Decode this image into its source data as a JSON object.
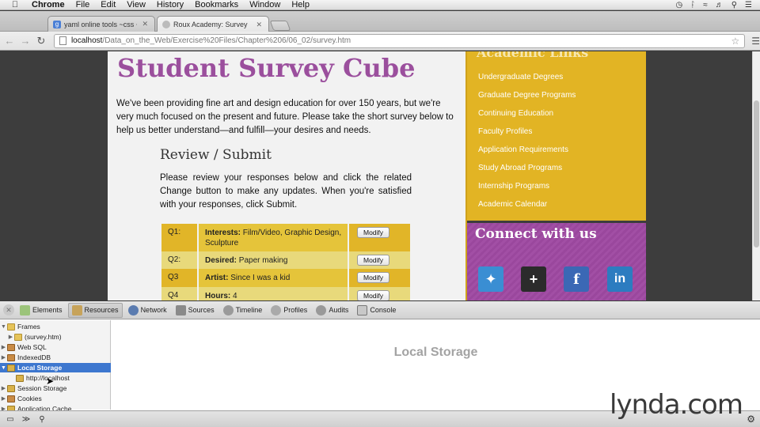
{
  "menubar": {
    "app": "Chrome",
    "items": [
      "File",
      "Edit",
      "View",
      "History",
      "Bookmarks",
      "Window",
      "Help"
    ]
  },
  "tabs": [
    {
      "title": "yaml online tools ~css ~ Go",
      "favicon": "g"
    },
    {
      "title": "Roux Academy: Survey",
      "favicon": ""
    }
  ],
  "address": {
    "host": "localhost",
    "path": "/Data_on_the_Web/Exercise%20Files/Chapter%206/06_02/survey.htm"
  },
  "page": {
    "title": "Student Survey Cube",
    "intro": "We've been providing fine art and design education for over 150 years, but we're very much focused on the present and future. Please take the short survey below to help us better understand—and fulfill—your desires and needs.",
    "section_title": "Review / Submit",
    "instructions": "Please review your responses below and click the related Change button to make any updates. When you're satisfied with your responses, click Submit.",
    "modify_label": "Modify",
    "responses": [
      {
        "id": "Q1:",
        "label": "Interests:",
        "answer": "Film/Video, Graphic Design, Sculpture"
      },
      {
        "id": "Q2:",
        "label": "Desired:",
        "answer": "Paper making"
      },
      {
        "id": "Q3",
        "label": "Artist:",
        "answer": "Since I was a kid"
      },
      {
        "id": "Q4",
        "label": "Hours:",
        "answer": "4"
      }
    ]
  },
  "sidebar": {
    "header": "Academic Links",
    "links": [
      "Undergraduate Degrees",
      "Graduate Degree Programs",
      "Continuing Education",
      "Faculty Profiles",
      "Application Requirements",
      "Study Abroad Programs",
      "Internship Programs",
      "Academic Calendar"
    ],
    "connect_title": "Connect with us"
  },
  "devtools": {
    "tabs": [
      "Elements",
      "Resources",
      "Network",
      "Sources",
      "Timeline",
      "Profiles",
      "Audits",
      "Console"
    ],
    "active_tab": "Resources",
    "tree": [
      {
        "label": "Frames",
        "level": 0,
        "expanded": true
      },
      {
        "label": "(survey.htm)",
        "level": 1,
        "expanded": false
      },
      {
        "label": "Web SQL",
        "level": 0,
        "expanded": false
      },
      {
        "label": "IndexedDB",
        "level": 0,
        "expanded": false
      },
      {
        "label": "Local Storage",
        "level": 0,
        "expanded": true,
        "selected": true
      },
      {
        "label": "http://localhost",
        "level": 1
      },
      {
        "label": "Session Storage",
        "level": 0,
        "expanded": false
      },
      {
        "label": "Cookies",
        "level": 0,
        "expanded": false
      },
      {
        "label": "Application Cache",
        "level": 0,
        "expanded": false
      }
    ],
    "main_title": "Local Storage"
  },
  "watermark": "lynda.com",
  "colors": {
    "title_purple": "#9b4f9d",
    "sidebar_gold": "#e2b424",
    "devtools_selection": "#3d77cf"
  }
}
